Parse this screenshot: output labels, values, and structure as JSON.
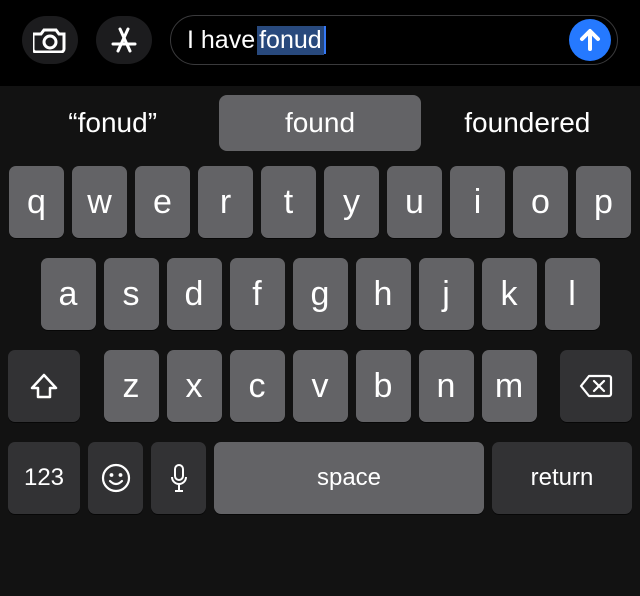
{
  "input": {
    "text_plain": "I have ",
    "text_highlight": "fonud"
  },
  "suggestions": {
    "left": "“fonud”",
    "center": "found",
    "right": "foundered"
  },
  "rows": {
    "row1": [
      "q",
      "w",
      "e",
      "r",
      "t",
      "y",
      "u",
      "i",
      "o",
      "p"
    ],
    "row2": [
      "a",
      "s",
      "d",
      "f",
      "g",
      "h",
      "j",
      "k",
      "l"
    ],
    "row3": [
      "z",
      "x",
      "c",
      "v",
      "b",
      "n",
      "m"
    ]
  },
  "bottom": {
    "mode": "123",
    "space": "space",
    "return": "return"
  },
  "icons": {
    "camera": "camera-icon",
    "appstore": "appstore-icon",
    "send": "send-icon",
    "shift": "shift-icon",
    "backspace": "backspace-icon",
    "emoji": "emoji-icon",
    "mic": "mic-icon"
  }
}
